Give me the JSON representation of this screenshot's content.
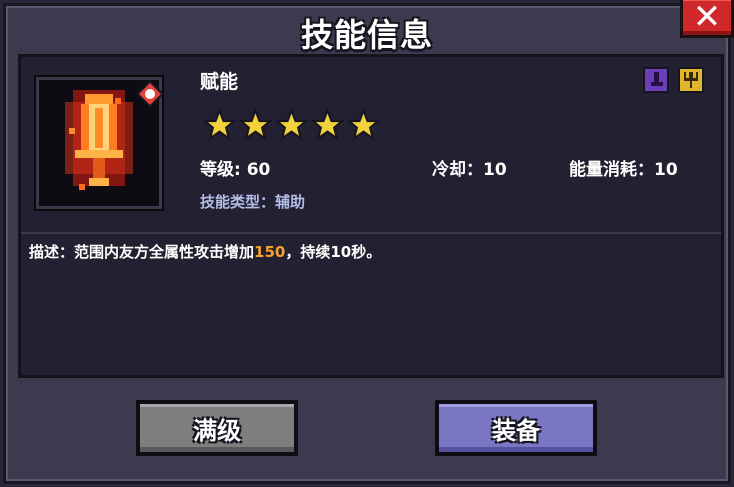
{
  "dialog": {
    "title": "技能信息",
    "close_label": "✕"
  },
  "skill": {
    "name": "赋能",
    "stars": 5,
    "level_text": "等级: 60",
    "cooldown_text": "冷却：10",
    "energy_text": "能量消耗：10",
    "type_text": "技能类型：辅助",
    "description_prefix": "描述：范围内友方全属性攻击增加",
    "description_value": "150",
    "description_suffix": "，持续10秒。"
  },
  "buttons": {
    "max_label": "满级",
    "equip_label": "装备"
  },
  "icons": {
    "skill": "flaming-sword-icon",
    "gem": "red-gem-icon",
    "tag_1": "purple-boot-icon",
    "tag_2": "gold-trident-icon",
    "star": "star-icon"
  },
  "colors": {
    "highlight": "#f3a32c",
    "star": "#f2d23a",
    "close_button": "#d0282a",
    "equip_button": "#7a76c4",
    "max_button": "#7e7e7e"
  }
}
